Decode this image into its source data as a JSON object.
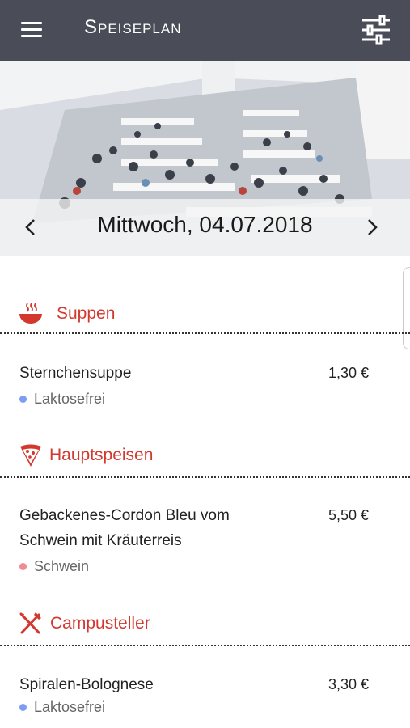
{
  "app": {
    "title": "Speiseplan"
  },
  "colors": {
    "appbar": "#4a4c57",
    "accent": "#d2382e",
    "laktosefrei": "#7f9cf5",
    "schwein": "#f08a96"
  },
  "icons": {
    "menu": "hamburger-icon",
    "filter": "sliders-icon",
    "prev": "chevron-left-icon",
    "next": "chevron-right-icon"
  },
  "date": {
    "label": "Mittwoch, 04.07.2018"
  },
  "sections": [
    {
      "title": "Suppen",
      "icon": "soup-bowl-icon",
      "items": [
        {
          "name": "Sternchensuppe",
          "price": "1,30 €",
          "tag": "Laktosefrei"
        }
      ]
    },
    {
      "title": "Hauptspeisen",
      "icon": "pizza-slice-icon",
      "items": [
        {
          "name": "Gebackenes-Cordon Bleu vom Schwein mit Kräuterreis",
          "price": "5,50 €",
          "tag": "Schwein"
        }
      ]
    },
    {
      "title": "Campusteller",
      "icon": "fork-knife-icon",
      "items": [
        {
          "name": "Spiralen-Bolognese",
          "price": "3,30 €",
          "tag": "Laktosefrei"
        }
      ]
    }
  ]
}
